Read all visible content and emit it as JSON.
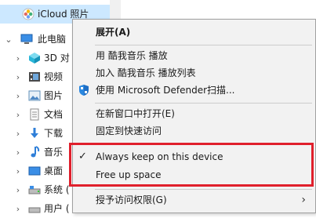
{
  "nav": {
    "items": [
      {
        "label": "iCloud 照片",
        "icon": "icloud-photos-icon"
      },
      {
        "label": "此电脑",
        "icon": "this-pc-icon"
      },
      {
        "label": "3D 对",
        "icon": "3d-objects-icon"
      },
      {
        "label": "视频",
        "icon": "videos-icon"
      },
      {
        "label": "图片",
        "icon": "pictures-icon"
      },
      {
        "label": "文档",
        "icon": "documents-icon"
      },
      {
        "label": "下载",
        "icon": "downloads-icon"
      },
      {
        "label": "音乐",
        "icon": "music-icon"
      },
      {
        "label": "桌面",
        "icon": "desktop-icon"
      },
      {
        "label": "系统 (",
        "icon": "system-drive-icon"
      },
      {
        "label": "用户 (",
        "icon": "user-drive-icon"
      }
    ]
  },
  "menu": {
    "expand": "展开(A)",
    "play_kugou": "用 酷我音乐 播放",
    "add_playlist": "加入 酷我音乐 播放列表",
    "defender_scan": "使用 Microsoft Defender扫描...",
    "open_new_window": "在新窗口中打开(E)",
    "pin_quick_access": "固定到快速访问",
    "always_keep": "Always keep on this device",
    "free_space": "Free up space",
    "grant_access": "授予访问权限(G)"
  },
  "colors": {
    "highlight_border": "#e0202c",
    "selected_row": "#cce8ff",
    "menu_background": "#f2f2f2"
  }
}
